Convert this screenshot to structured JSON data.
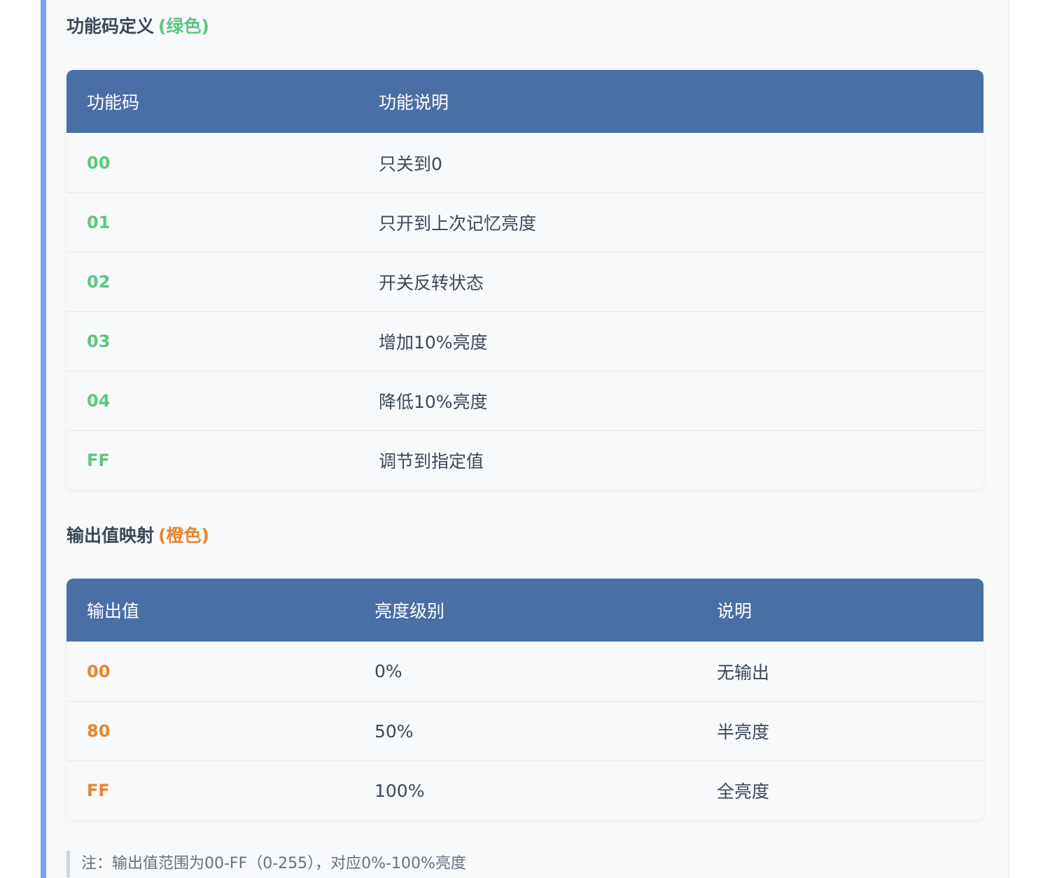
{
  "section1": {
    "title": "功能码定义",
    "tag": "(绿色)",
    "headers": [
      "功能码",
      "功能说明"
    ],
    "rows": [
      {
        "code": "00",
        "desc": "只关到0"
      },
      {
        "code": "01",
        "desc": "只开到上次记忆亮度"
      },
      {
        "code": "02",
        "desc": "开关反转状态"
      },
      {
        "code": "03",
        "desc": "增加10%亮度"
      },
      {
        "code": "04",
        "desc": "降低10%亮度"
      },
      {
        "code": "FF",
        "desc": "调节到指定值"
      }
    ]
  },
  "section2": {
    "title": "输出值映射",
    "tag": "(橙色)",
    "headers": [
      "输出值",
      "亮度级别",
      "说明"
    ],
    "rows": [
      {
        "value": "00",
        "level": "0%",
        "desc": "无输出"
      },
      {
        "value": "80",
        "level": "50%",
        "desc": "半亮度"
      },
      {
        "value": "FF",
        "level": "100%",
        "desc": "全亮度"
      }
    ]
  },
  "note": "注：输出值范围为00-FF（0-255），对应0%-100%亮度",
  "colors": {
    "header_bg": "#4a6fa5",
    "green": "#5cc77e",
    "orange": "#e8862f",
    "accent_bar": "#7aa7ea"
  }
}
